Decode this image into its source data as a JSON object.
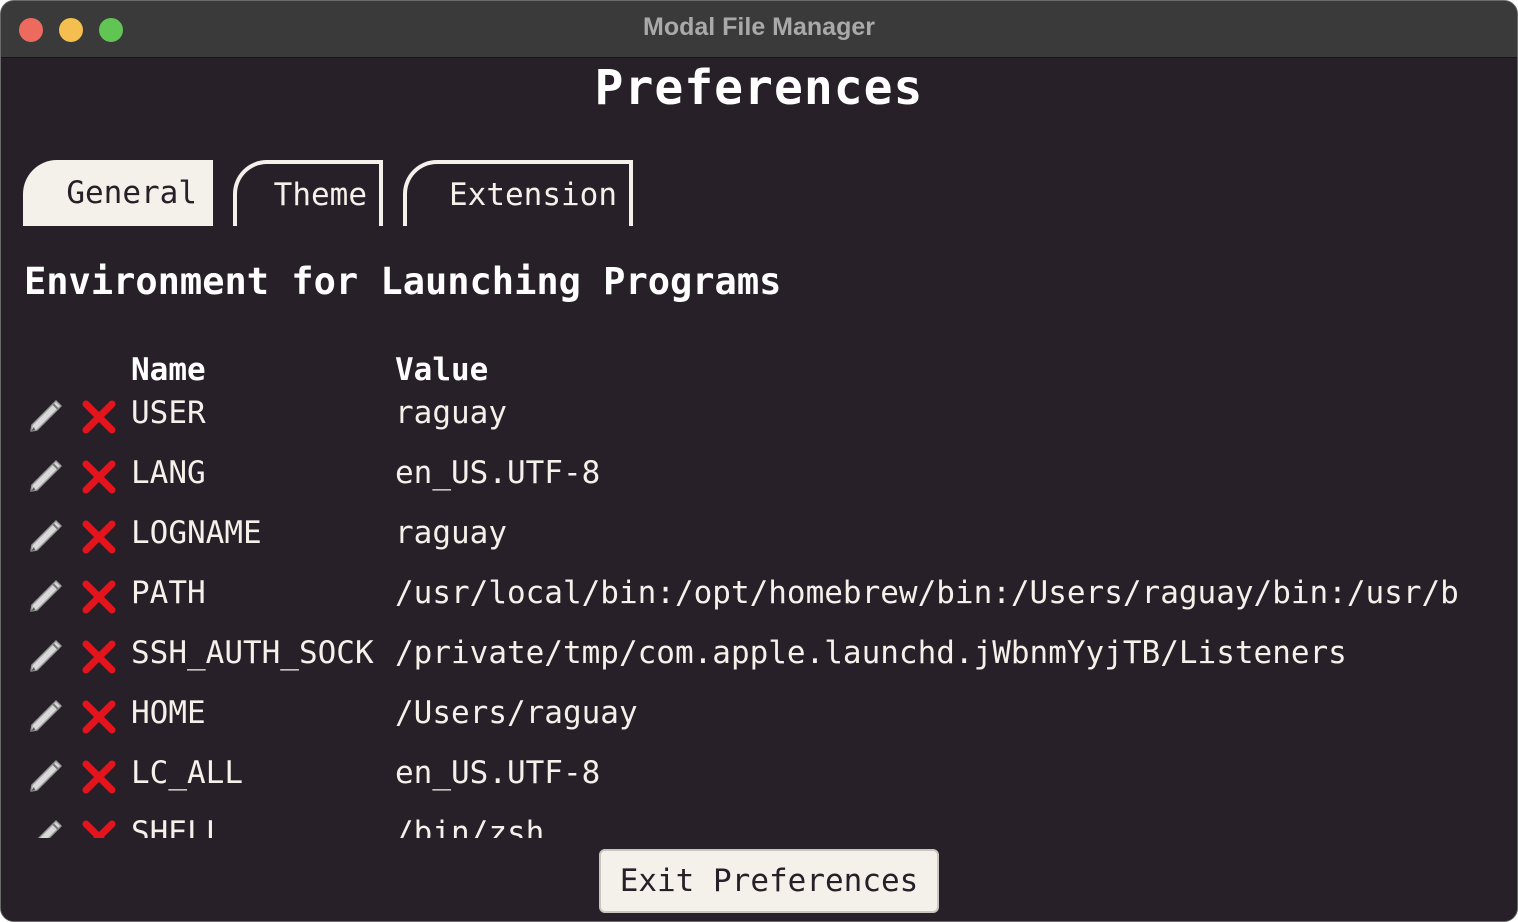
{
  "window": {
    "title": "Modal File Manager"
  },
  "page": {
    "title": "Preferences"
  },
  "tabs": [
    {
      "label": "General",
      "active": true
    },
    {
      "label": "Theme",
      "active": false
    },
    {
      "label": "Extension",
      "active": false
    }
  ],
  "section": {
    "heading": "Environment for Launching Programs"
  },
  "table": {
    "headers": {
      "name": "Name",
      "value": "Value"
    },
    "rows": [
      {
        "name": "USER",
        "value": "raguay"
      },
      {
        "name": "LANG",
        "value": "en_US.UTF-8"
      },
      {
        "name": "LOGNAME",
        "value": "raguay"
      },
      {
        "name": "PATH",
        "value": "/usr/local/bin:/opt/homebrew/bin:/Users/raguay/bin:/usr/b"
      },
      {
        "name": "SSH_AUTH_SOCK",
        "value": "/private/tmp/com.apple.launchd.jWbnmYyjTB/Listeners"
      },
      {
        "name": "HOME",
        "value": "/Users/raguay"
      },
      {
        "name": "LC_ALL",
        "value": "en_US.UTF-8"
      },
      {
        "name": "SHELL",
        "value": "/bin/zsh"
      }
    ]
  },
  "footer": {
    "exit_label": "Exit Preferences"
  },
  "colors": {
    "background": "#282028",
    "foreground": "#f4f1ea",
    "delete": "#e3141b",
    "titlebar": "#3a3a3a"
  },
  "icons": {
    "edit": "pencil-icon",
    "delete": "red-x-icon"
  }
}
